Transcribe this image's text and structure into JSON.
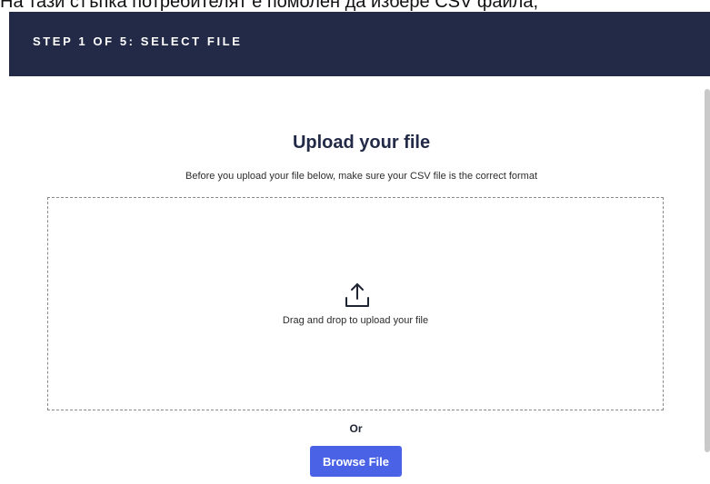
{
  "caption": {
    "text": "На тази стъпка потребителят е помолен да избере CSV файла,"
  },
  "header": {
    "step_title": "STEP 1 OF 5: SELECT FILE",
    "background_color": "#222a47"
  },
  "upload": {
    "title": "Upload your file",
    "subtitle": "Before you upload your file below, make sure your CSV file is the correct format",
    "dropzone_icon": "upload-icon",
    "dropzone_text": "Drag and drop to upload your file",
    "or_text": "Or",
    "browse_label": "Browse File",
    "accent_color": "#4a63e6"
  }
}
